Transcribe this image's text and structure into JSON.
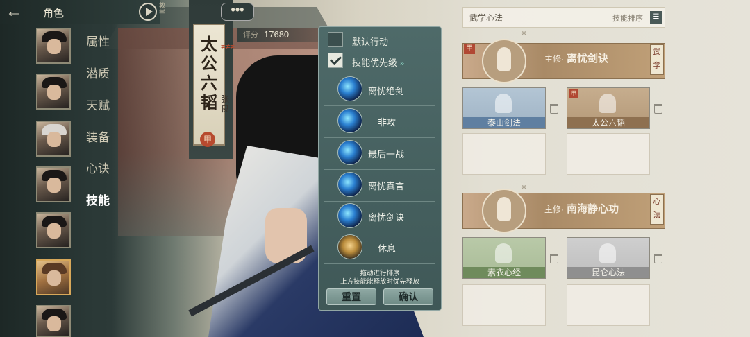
{
  "header": {
    "title": "角色",
    "tutorial_label": "教学"
  },
  "left_menu": [
    {
      "label": "属性",
      "active": false
    },
    {
      "label": "潜质",
      "active": false
    },
    {
      "label": "天赋",
      "active": false
    },
    {
      "label": "装备",
      "active": false
    },
    {
      "label": "心诀",
      "active": false
    },
    {
      "label": "技能",
      "active": true
    }
  ],
  "character": {
    "weapon_title": "太公六韬",
    "sub_name": "张良",
    "grade_seal": "甲",
    "score_label": "评分",
    "score_value": "17680",
    "speech": "•••"
  },
  "popup": {
    "default_action": {
      "label": "默认行动",
      "checked": false
    },
    "priority": {
      "label": "技能优先级",
      "checked": true
    },
    "skills": [
      {
        "name": "离忧绝剑",
        "icon": "blue-sword-swirl-icon"
      },
      {
        "name": "非攻",
        "icon": "blue-wave-icon"
      },
      {
        "name": "最后一战",
        "icon": "blue-burst-icon"
      },
      {
        "name": "离忧真言",
        "icon": "blue-vortex-icon"
      },
      {
        "name": "离忧剑诀",
        "icon": "blue-slash-icon"
      },
      {
        "name": "休息",
        "icon": "meditation-icon"
      }
    ],
    "hint_line1": "拖动进行排序",
    "hint_line2": "上方技能能释放时优先释放",
    "reset_label": "重置",
    "confirm_label": "确认"
  },
  "right_panel": {
    "title": "武学心法",
    "sort_label": "技能排序",
    "martial": {
      "grade": "甲",
      "main_prefix": "主修·",
      "main_name": "离忧剑诀",
      "side_tag": "武学",
      "cards": [
        {
          "name": "泰山剑法",
          "style": "blue"
        },
        {
          "name": "太公六韬",
          "style": "brown",
          "grade": "甲"
        }
      ]
    },
    "heart": {
      "main_prefix": "主修·",
      "main_name": "南海静心功",
      "side_tag": "心法",
      "cards": [
        {
          "name": "素衣心经",
          "style": "green"
        },
        {
          "name": "昆仑心法",
          "style": "gray"
        }
      ]
    }
  },
  "colors": {
    "accent": "#8fd9c9",
    "popup_bg": "#4e6a69",
    "seal_red": "#b14833"
  }
}
